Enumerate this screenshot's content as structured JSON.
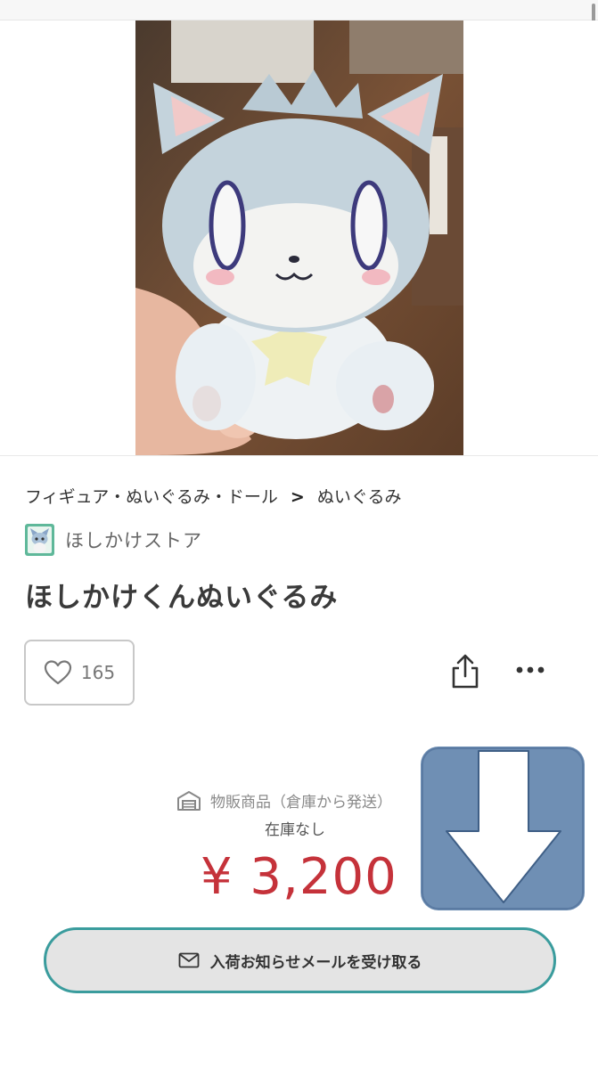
{
  "breadcrumb": {
    "parent": "フィギュア・ぬいぐるみ・ドール",
    "separator": ">",
    "current": "ぬいぐるみ"
  },
  "shop": {
    "name": "ほしかけストア",
    "avatar_icon": "shop-avatar-icon"
  },
  "product": {
    "title": "ほしかけくんぬいぐるみ",
    "like_count": "165",
    "warehouse_label": "物販商品（倉庫から発送）",
    "stock_status": "在庫なし",
    "price": "¥ 3,200"
  },
  "actions": {
    "notify_label": "入荷お知らせメールを受け取る"
  },
  "colors": {
    "price": "#c5323a",
    "notify_border": "#3a9c9d",
    "overlay_arrow_bg": "#6f8fb4"
  }
}
